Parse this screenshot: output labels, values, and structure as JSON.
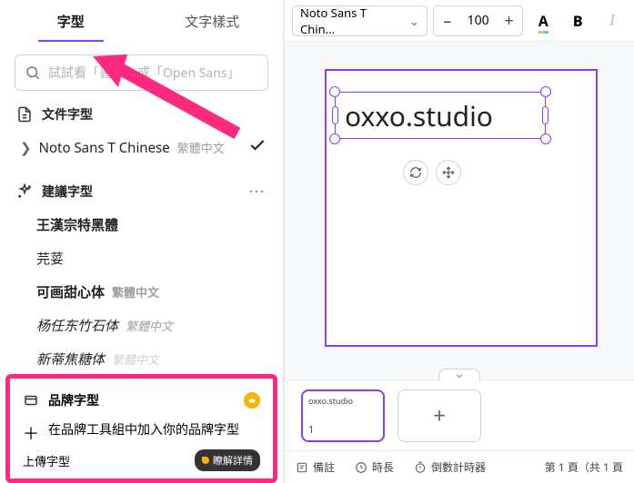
{
  "tabs": {
    "font": "字型",
    "style": "文字樣式"
  },
  "search": {
    "placeholder": "試試看「書法」或「Open Sans」"
  },
  "doc_fonts": {
    "label": "文件字型",
    "item": {
      "name": "Noto Sans T Chinese",
      "sub": "繁體中文"
    }
  },
  "suggested": {
    "label": "建議字型",
    "items": [
      {
        "name": "王漢宗特黑體",
        "sub": "",
        "bold": true
      },
      {
        "name": "芫荽",
        "sub": ""
      },
      {
        "name": "可画甜心体",
        "sub": "繁體中文",
        "bold": true
      },
      {
        "name": "杨任东竹石体",
        "sub": "繁體中文"
      },
      {
        "name": "新蒂焦糖体",
        "sub": "繁體中文"
      }
    ]
  },
  "promo": {
    "brand_label": "品牌字型",
    "add_label": "在品牌工具組中加入你的品牌字型",
    "upload_label": "上傳字型",
    "detail_label": "瞭解詳情"
  },
  "toolbar": {
    "font_name": "Noto Sans T Chin...",
    "font_size": "100",
    "color_letter": "A",
    "bold_letter": "B",
    "italic_letter": "I"
  },
  "canvas": {
    "text_content": "oxxo.studio",
    "thumb_text": "oxxo.studio",
    "thumb_num": "1"
  },
  "footer": {
    "notes": "備註",
    "duration": "時長",
    "timer": "倒數計時器",
    "page_info": "第 1 頁（共 1 頁"
  }
}
